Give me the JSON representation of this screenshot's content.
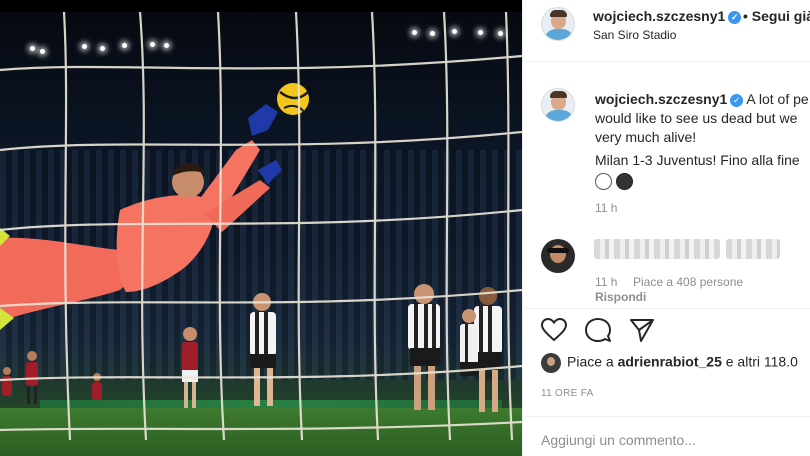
{
  "post": {
    "username": "wojciech.szczesny1",
    "verified_mark": "✓",
    "follow_label": "• Segui già",
    "location": "San Siro Stadio"
  },
  "caption": {
    "username": "wojciech.szczesny1",
    "lines": [
      "A lot of pe",
      "would like to see us dead but we",
      "very much alive!",
      "Milan 1-3 Juventus! Fino alla fine"
    ],
    "emojis": [
      "white-circle",
      "black-circle"
    ],
    "time": "11 h"
  },
  "comment": {
    "time": "11 h",
    "likes": "Piace a 408 persone",
    "reply": "Rispondi"
  },
  "actions": {
    "icons": [
      "heart-icon",
      "comment-icon",
      "share-icon"
    ]
  },
  "likes": {
    "prefix": "Piace a ",
    "user": "adrienrabiot_25",
    "suffix": " e altri 118.0"
  },
  "timestamp": "11 ORE FA",
  "add_comment_placeholder": "Aggiungi un commento...",
  "colors": {
    "verified": "#3897f0",
    "text": "#262626",
    "muted": "#8e8e8e",
    "keeper_kit": "#f26a5a",
    "ball": "#f2c61c"
  }
}
